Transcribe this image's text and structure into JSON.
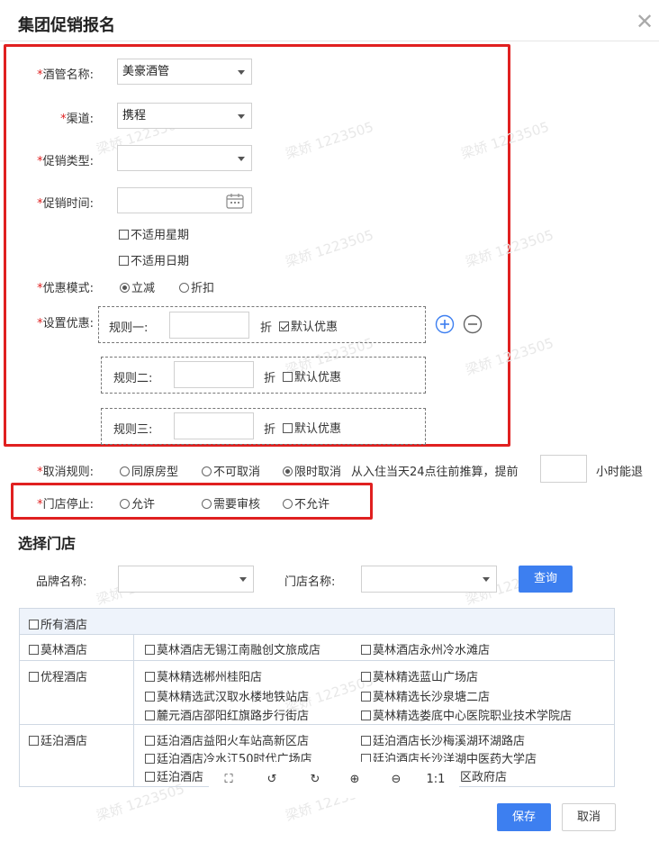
{
  "dialog": {
    "title": "集团促销报名"
  },
  "form": {
    "hotel_label": "酒管名称:",
    "hotel_value": "美豪酒管",
    "channel_label": "渠道:",
    "channel_value": "携程",
    "promo_type_label": "促销类型:",
    "promo_type_value": "",
    "promo_time_label": "促销时间:",
    "exclude_weekday": "不适用星期",
    "exclude_date": "不适用日期",
    "discount_mode_label": "优惠模式:",
    "mode_reduce": "立减",
    "mode_discount": "折扣",
    "set_discount_label": "设置优惠:",
    "rules": [
      {
        "label": "规则一:",
        "unit": "折",
        "default_label": "默认优惠",
        "checked": true
      },
      {
        "label": "规则二:",
        "unit": "折",
        "default_label": "默认优惠",
        "checked": false
      },
      {
        "label": "规则三:",
        "unit": "折",
        "default_label": "默认优惠",
        "checked": false
      }
    ],
    "cancel_label": "取消规则:",
    "cancel_opt1": "同原房型",
    "cancel_opt2": "不可取消",
    "cancel_opt3": "限时取消",
    "cancel_desc": "从入住当天24点往前推算，提前",
    "cancel_suffix": "小时能退",
    "store_stop_label": "门店停止:",
    "stop_opt1": "允许",
    "stop_opt2": "需要审核",
    "stop_opt3": "不允许"
  },
  "store": {
    "section_title": "选择门店",
    "brand_label": "品牌名称:",
    "store_label": "门店名称:",
    "query_button": "查询",
    "all_hotels": "所有酒店",
    "groups": [
      {
        "name": "莫林酒店",
        "stores": [
          "莫林酒店无锡江南融创文旅成店",
          "莫林酒店永州冷水滩店"
        ]
      },
      {
        "name": "优程酒店",
        "stores": [
          "莫林精选郴州桂阳店",
          "莫林精选蓝山广场店",
          "莫林精选武汉取水楼地铁站店",
          "莫林精选长沙泉塘二店",
          "麓元酒店邵阳红旗路步行街店",
          "莫林精选娄底中心医院职业技术学院店"
        ]
      },
      {
        "name": "廷泊酒店",
        "stores": [
          "廷泊酒店益阳火车站高新区店",
          "廷泊酒店长沙梅溪湖环湖路店",
          "廷泊酒店",
          "廷泊酒店",
          "廷泊酒店",
          "区政府店"
        ]
      }
    ]
  },
  "partial_text": {
    "r2c1": "廷泊酒店冷水江50时代广场店",
    "r2c2": "廷泊酒店长沙洋湖中医药大学店"
  },
  "toolbar": {
    "fullscreen": "⛶",
    "rotate_left": "↺",
    "rotate_right": "↻",
    "zoom_in": "⊕",
    "zoom_out": "⊖",
    "actual_size": "1:1"
  },
  "footer": {
    "save": "保存",
    "cancel": "取消"
  },
  "watermark": "梁娇 1223505",
  "colors": {
    "required": "#e02020",
    "primary": "#3d7ff0",
    "highlight_box": "#e02020"
  }
}
